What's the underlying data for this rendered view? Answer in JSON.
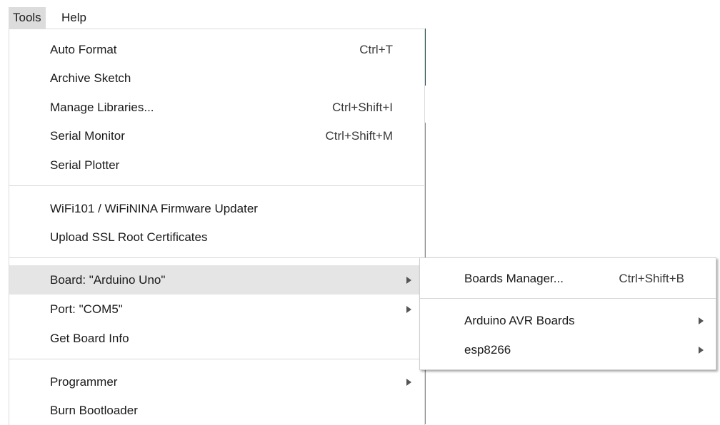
{
  "menubar": {
    "tools": "Tools",
    "help": "Help"
  },
  "tools_menu": {
    "auto_format": {
      "label": "Auto Format",
      "shortcut": "Ctrl+T"
    },
    "archive_sketch": {
      "label": "Archive Sketch"
    },
    "manage_libraries": {
      "label": "Manage Libraries...",
      "shortcut": "Ctrl+Shift+I"
    },
    "serial_monitor": {
      "label": "Serial Monitor",
      "shortcut": "Ctrl+Shift+M"
    },
    "serial_plotter": {
      "label": "Serial Plotter"
    },
    "firmware_updater": {
      "label": "WiFi101 / WiFiNINA Firmware Updater"
    },
    "upload_ssl": {
      "label": "Upload SSL Root Certificates"
    },
    "board": {
      "label": "Board: \"Arduino Uno\""
    },
    "port": {
      "label": "Port: \"COM5\""
    },
    "board_info": {
      "label": "Get Board Info"
    },
    "programmer": {
      "label": "Programmer"
    },
    "burn_bootloader": {
      "label": "Burn Bootloader"
    }
  },
  "board_submenu": {
    "boards_manager": {
      "label": "Boards Manager...",
      "shortcut": "Ctrl+Shift+B"
    },
    "avr_boards": {
      "label": "Arduino AVR Boards"
    },
    "esp8266": {
      "label": "esp8266"
    }
  },
  "colors": {
    "highlight": "#e5e5e5",
    "menu_tools_active": "#dcdcdc"
  }
}
